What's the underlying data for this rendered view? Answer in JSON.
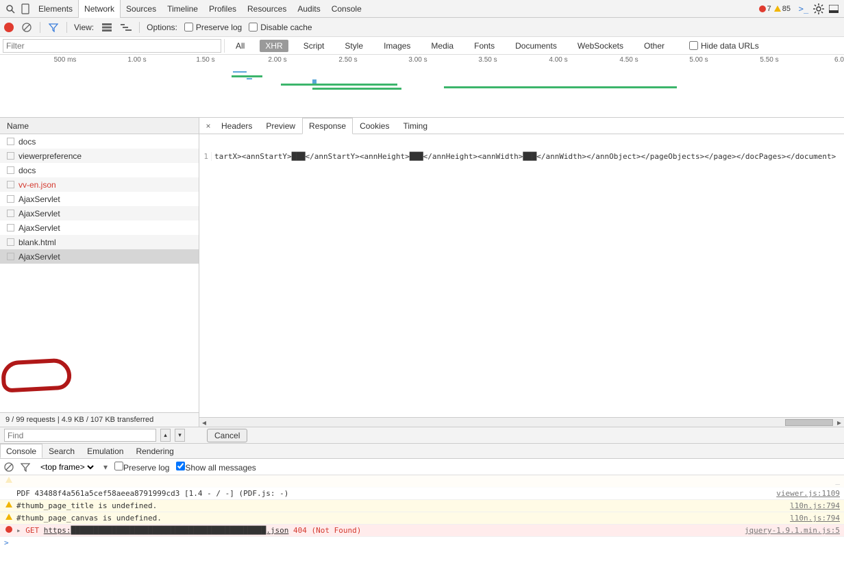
{
  "topTabs": {
    "items": [
      "Elements",
      "Network",
      "Sources",
      "Timeline",
      "Profiles",
      "Resources",
      "Audits",
      "Console"
    ],
    "active": 1
  },
  "statusBadges": {
    "errors": "7",
    "warnings": "85"
  },
  "netToolbar": {
    "viewLabel": "View:",
    "optionsLabel": "Options:",
    "preserveLog": "Preserve log",
    "disableCache": "Disable cache"
  },
  "filterPlaceholder": "Filter",
  "typeFilters": {
    "items": [
      "All",
      "XHR",
      "Script",
      "Style",
      "Images",
      "Media",
      "Fonts",
      "Documents",
      "WebSockets",
      "Other"
    ],
    "active": 1,
    "hideDataUrls": "Hide data URLs"
  },
  "timelineTicks": [
    "500 ms",
    "1.00 s",
    "1.50 s",
    "2.00 s",
    "2.50 s",
    "3.00 s",
    "3.50 s",
    "4.00 s",
    "4.50 s",
    "5.00 s",
    "5.50 s",
    "6.0"
  ],
  "nameHeader": "Name",
  "requests": [
    {
      "name": "docs",
      "special": ""
    },
    {
      "name": "viewerpreference",
      "special": ""
    },
    {
      "name": "docs",
      "special": ""
    },
    {
      "name": "vv-en.json",
      "special": "red"
    },
    {
      "name": "AjaxServlet",
      "special": ""
    },
    {
      "name": "AjaxServlet",
      "special": ""
    },
    {
      "name": "AjaxServlet",
      "special": ""
    },
    {
      "name": "blank.html",
      "special": ""
    },
    {
      "name": "AjaxServlet",
      "special": "selected"
    }
  ],
  "requestStatus": "9 / 99 requests | 4.9 KB / 107 KB transferred",
  "detailTabs": {
    "items": [
      "Headers",
      "Preview",
      "Response",
      "Cookies",
      "Timing"
    ],
    "active": 2,
    "close": "×"
  },
  "responseLineNo": "1",
  "responseText": "tartX><annStartY>███</annStartY><annHeight>███</annHeight><annWidth>███</annWidth></annObject></pageObjects></page></docPages></document>",
  "find": {
    "placeholder": "Find",
    "cancel": "Cancel"
  },
  "drawerTabs": {
    "items": [
      "Console",
      "Search",
      "Emulation",
      "Rendering"
    ],
    "active": 0
  },
  "consoleCtrls": {
    "frameSelect": "<top frame>",
    "preserveLog": "Preserve log",
    "showAll": "Show all messages"
  },
  "consoleRows": [
    {
      "type": "plain",
      "msg": "PDF 43488f4a561a5cef58aeea8791999cd3 [1.4 - / -] (PDF.js: -)",
      "src": "viewer.js:1109"
    },
    {
      "type": "warn",
      "msg": "#thumb_page_title is undefined.",
      "src": "l10n.js:794"
    },
    {
      "type": "warn",
      "msg": "#thumb_page_canvas is undefined.",
      "src": "l10n.js:794"
    },
    {
      "type": "err",
      "prefix": "GET ",
      "url": "https:███████████████████████████████████████████.json",
      "status": "404 (Not Found)",
      "src": "jquery-1.9.1.min.js:5"
    }
  ],
  "prompt": ">"
}
